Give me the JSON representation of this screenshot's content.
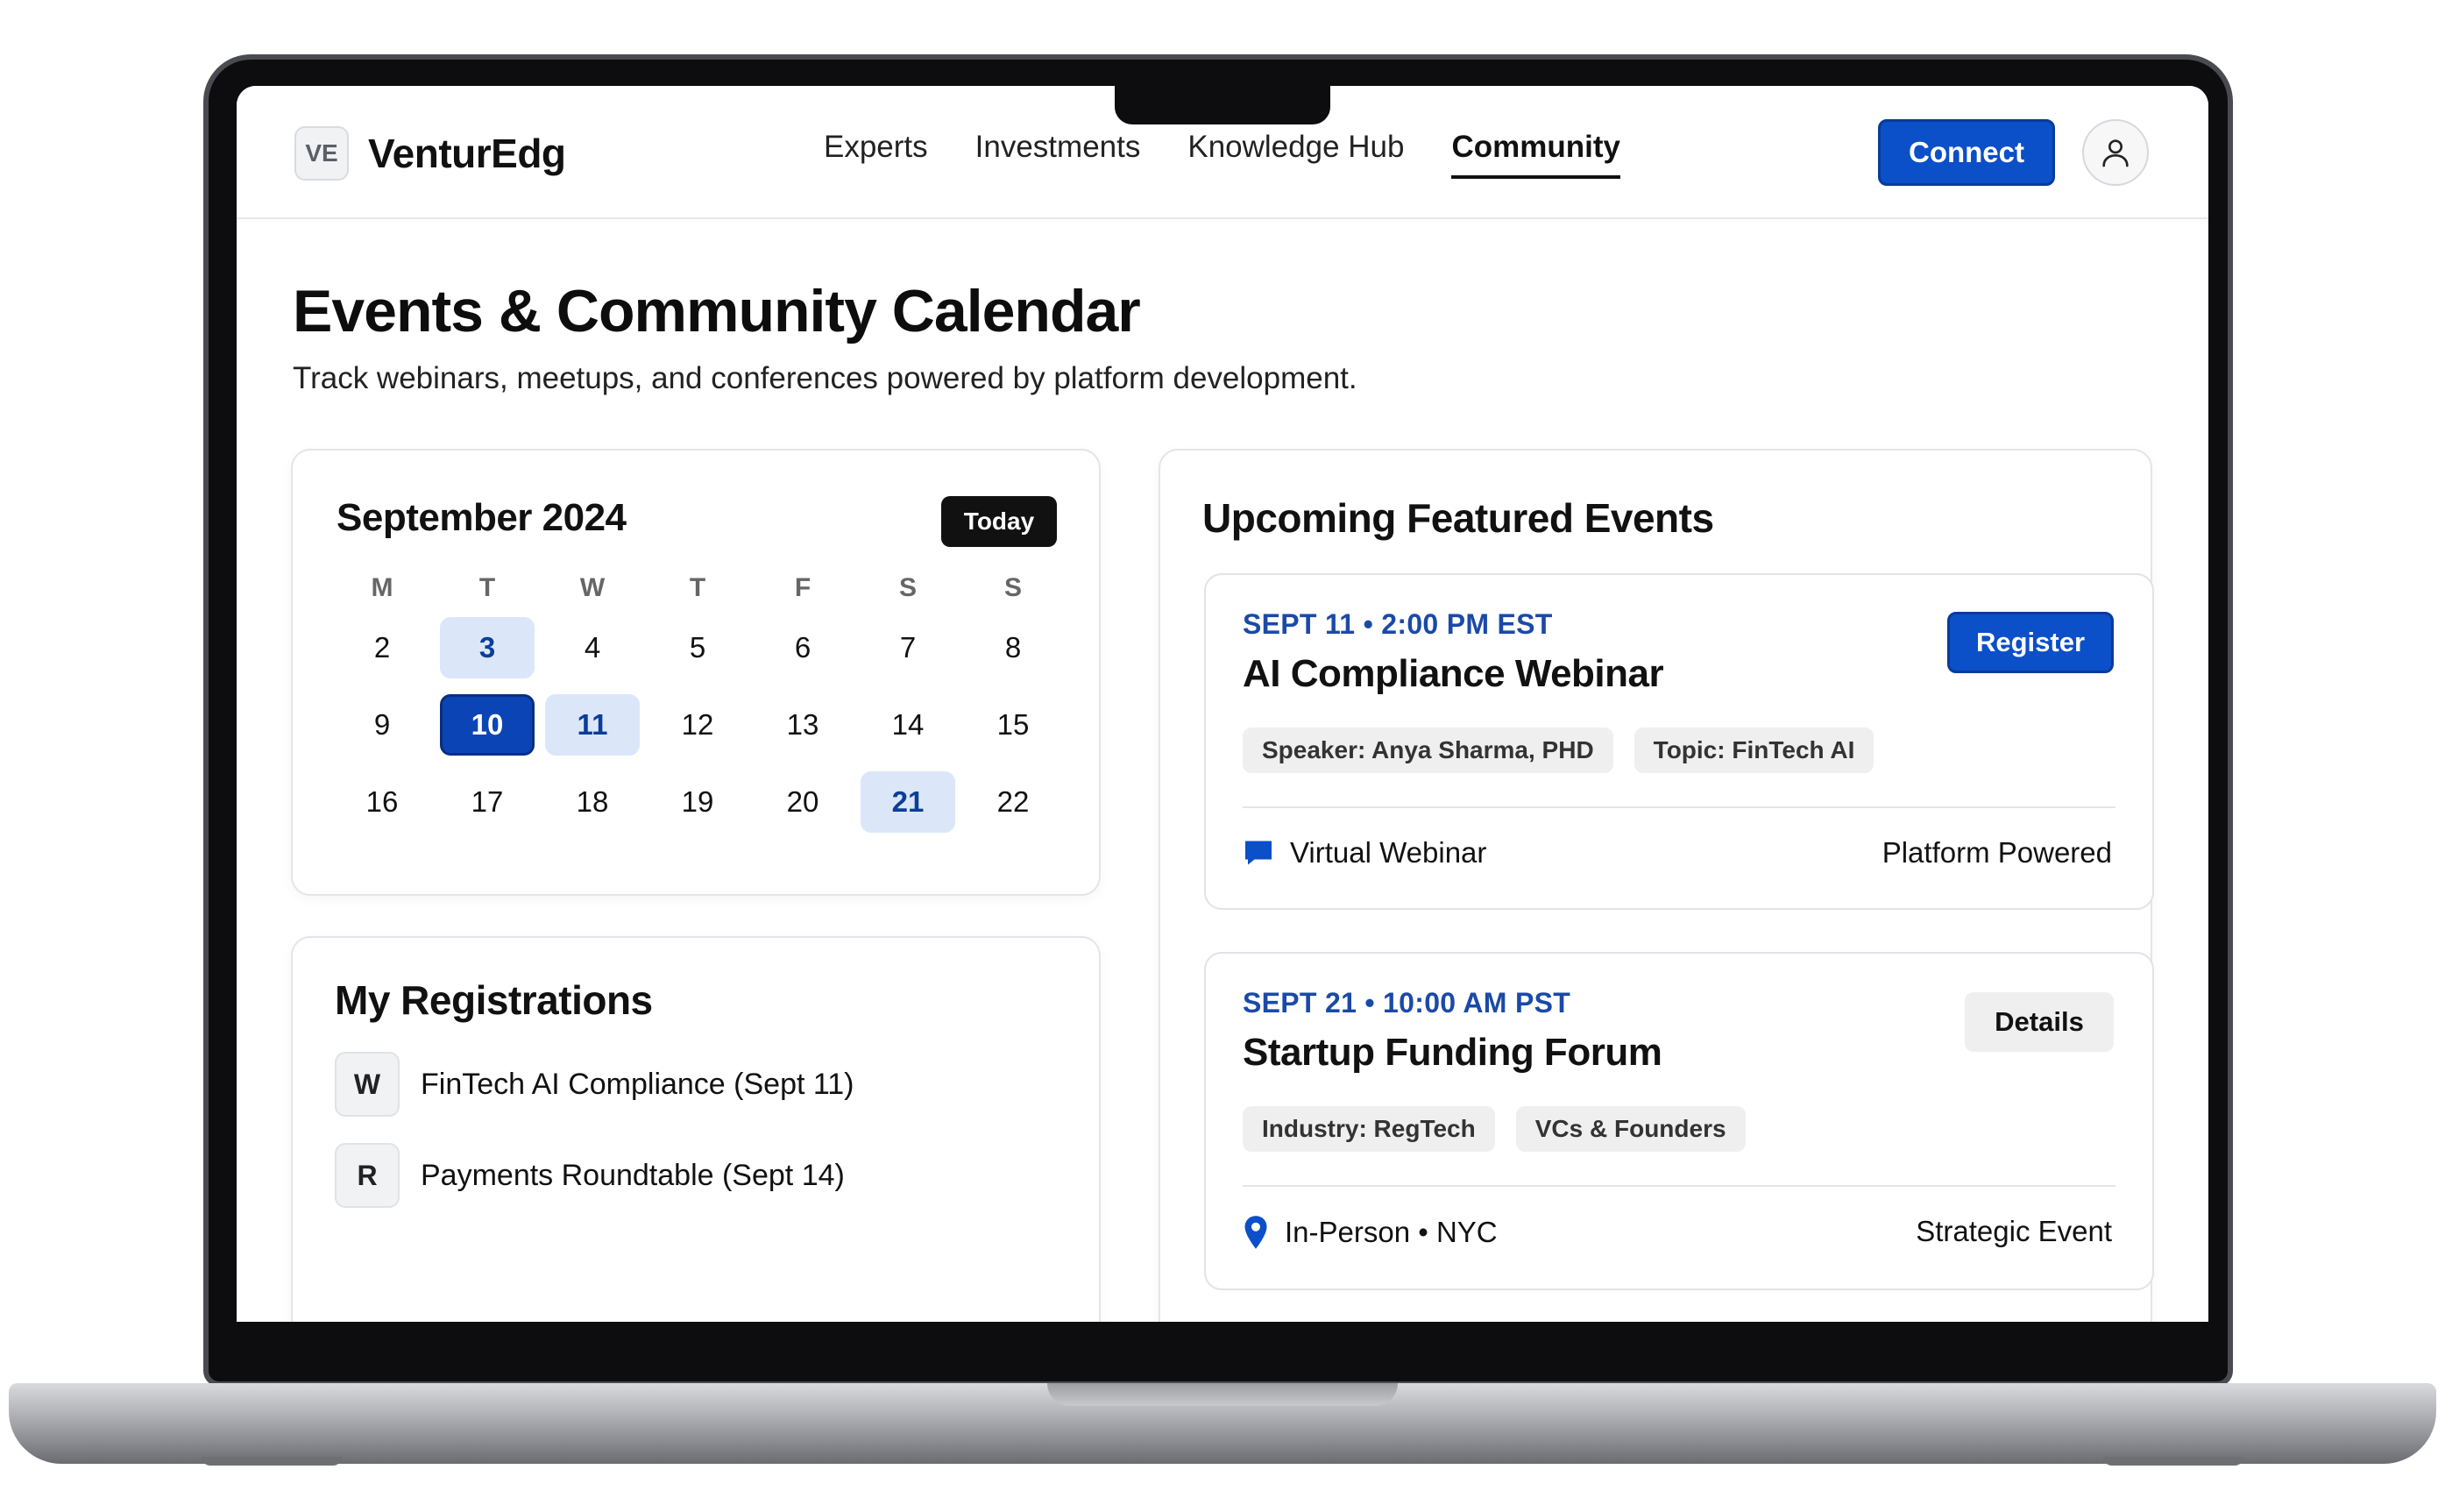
{
  "brand": {
    "badge": "VE",
    "name": "VenturEdg"
  },
  "nav": {
    "items": [
      "Experts",
      "Investments",
      "Knowledge Hub",
      "Community"
    ],
    "active": "Community"
  },
  "header": {
    "connect_label": "Connect",
    "profile_icon": "user-icon"
  },
  "page": {
    "title": "Events & Community Calendar",
    "subtitle": "Track webinars, meetups, and conferences powered by platform development."
  },
  "calendar": {
    "month_label": "September 2024",
    "today_label": "Today",
    "weekdays": [
      "M",
      "T",
      "W",
      "T",
      "F",
      "S",
      "S"
    ],
    "weeks": [
      [
        "2",
        "3",
        "4",
        "5",
        "6",
        "7",
        "8"
      ],
      [
        "9",
        "10",
        "11",
        "12",
        "13",
        "14",
        "15"
      ],
      [
        "16",
        "17",
        "18",
        "19",
        "20",
        "21",
        "22"
      ]
    ],
    "selected_day": "10",
    "highlighted_days": [
      "3",
      "11",
      "21"
    ],
    "colors": {
      "selected": "#0b45b5",
      "highlight": "#dbe7f8"
    }
  },
  "registrations": {
    "title": "My Registrations",
    "items": [
      {
        "badge": "W",
        "label": "FinTech AI Compliance (Sept 11)"
      },
      {
        "badge": "R",
        "label": "Payments Roundtable (Sept 14)"
      }
    ]
  },
  "events": {
    "title": "Upcoming Featured Events",
    "items": [
      {
        "date_time": "SEPT 11 • 2:00 PM EST",
        "name": "AI Compliance Webinar",
        "action_label": "Register",
        "action_style": "primary",
        "tags": [
          "Speaker: Anya Sharma, PHD",
          "Topic: FinTech AI"
        ],
        "location_icon": "chat-bubble-icon",
        "location": "Virtual Webinar",
        "note": "Platform Powered"
      },
      {
        "date_time": "SEPT 21 • 10:00 AM PST",
        "name": "Startup Funding Forum",
        "action_label": "Details",
        "action_style": "secondary",
        "tags": [
          "Industry: RegTech",
          "VCs & Founders"
        ],
        "location_icon": "map-pin-icon",
        "location": "In-Person • NYC",
        "note": "Strategic Event"
      }
    ]
  },
  "colors": {
    "accent": "#0b4fc9",
    "date_text": "#1a4aa8"
  }
}
